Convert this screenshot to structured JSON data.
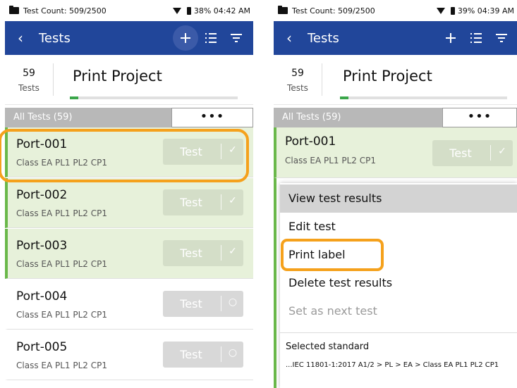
{
  "left": {
    "status": {
      "count": "Test Count: 509/2500",
      "battery": "38%",
      "time": "04:42 AM"
    },
    "appbar": {
      "title": "Tests"
    },
    "project": {
      "count": "59",
      "count_label": "Tests",
      "name": "Print Project",
      "progress": 0.05
    },
    "filter": {
      "label": "All Tests (59)",
      "more": "•••"
    },
    "rows": [
      {
        "name": "Port-001",
        "standard": "Class EA PL1 PL2 CP1",
        "button": "Test",
        "state": "done"
      },
      {
        "name": "Port-002",
        "standard": "Class EA PL1 PL2 CP1",
        "button": "Test",
        "state": "done"
      },
      {
        "name": "Port-003",
        "standard": "Class EA PL1 PL2 CP1",
        "button": "Test",
        "state": "done"
      },
      {
        "name": "Port-004",
        "standard": "Class EA PL1 PL2 CP1",
        "button": "Test",
        "state": "todo"
      },
      {
        "name": "Port-005",
        "standard": "Class EA PL1 PL2 CP1",
        "button": "Test",
        "state": "todo"
      }
    ]
  },
  "right": {
    "status": {
      "count": "Test Count: 509/2500",
      "battery": "39%",
      "time": "04:39 AM"
    },
    "appbar": {
      "title": "Tests"
    },
    "project": {
      "count": "59",
      "count_label": "Tests",
      "name": "Print Project",
      "progress": 0.05
    },
    "filter": {
      "label": "All Tests (59)",
      "more": "•••"
    },
    "row": {
      "name": "Port-001",
      "standard": "Class EA PL1 PL2 CP1",
      "button": "Test"
    },
    "menu": {
      "items": [
        "View test results",
        "Edit test",
        "Print label",
        "Delete test results",
        "Set as next test"
      ],
      "selected_standard_label": "Selected standard",
      "selected_standard_value": "...IEC 11801-1:2017 A1/2 > PL > EA > Class EA PL1 PL2 CP1"
    }
  },
  "colors": {
    "appbar": "#21469a",
    "highlight": "#f5a11c",
    "done_row": "#e7f1da",
    "done_bar": "#6ab84a"
  },
  "icons": [
    "back-icon",
    "plus-icon",
    "list-icon",
    "filter-icon",
    "check-icon",
    "circle-icon",
    "wifi-icon",
    "battery-icon"
  ]
}
